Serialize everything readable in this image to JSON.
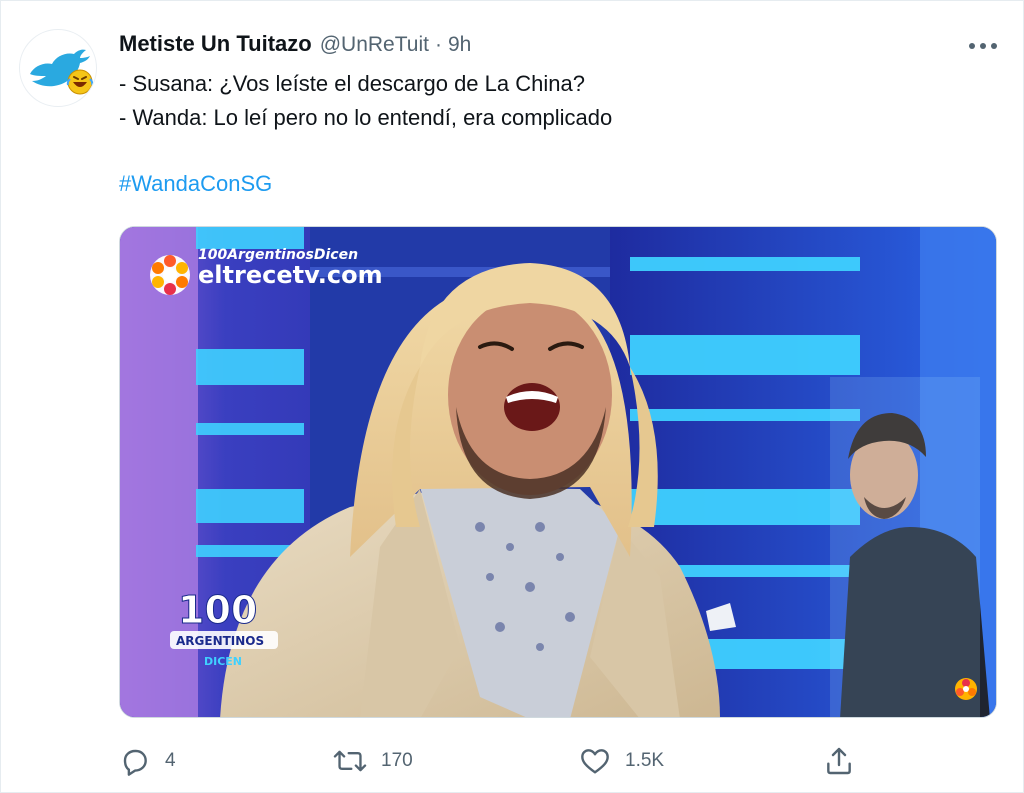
{
  "tweet": {
    "author": {
      "display_name": "Metiste Un Tuitazo",
      "handle": "@UnReTuit",
      "separator": "·",
      "time": "9h",
      "avatar_icon": "twitter-bird-laughing-icon"
    },
    "more_icon": "more-dots-icon",
    "text_lines": [
      "- Susana: ¿Vos leíste el descargo de La China?",
      "- Wanda: Lo leí pero no lo entendí, era complicado"
    ],
    "hashtag": "#WandaConSG",
    "media": {
      "watermark_small": "100ArgentinosDicen",
      "watermark_site": "eltrecetv.com",
      "show_logo_number": "100",
      "show_logo_word": "ARGENTINOS",
      "show_logo_sub": "DICEN"
    },
    "actions": {
      "reply": {
        "icon": "reply-icon",
        "count": "4"
      },
      "retweet": {
        "icon": "retweet-icon",
        "count": "170"
      },
      "like": {
        "icon": "heart-icon",
        "count": "1.5K"
      },
      "share": {
        "icon": "share-icon"
      }
    },
    "colors": {
      "accent": "#1d9bf0",
      "secondary_text": "#536471",
      "primary_text": "#0f1419"
    }
  }
}
